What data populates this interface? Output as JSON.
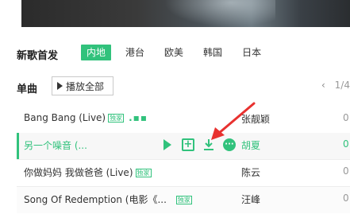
{
  "section": {
    "title": "新歌首发"
  },
  "tabs": [
    {
      "label": "内地",
      "active": true
    },
    {
      "label": "港台",
      "active": false
    },
    {
      "label": "欧美",
      "active": false
    },
    {
      "label": "韩国",
      "active": false
    },
    {
      "label": "日本",
      "active": false
    }
  ],
  "singles": {
    "title": "单曲",
    "play_all_label": "播放全部",
    "pager_text": "1/4"
  },
  "songs": [
    {
      "name": "Bang Bang (Live)",
      "tag": "独家",
      "singer": "张靓颖",
      "duration": "0"
    },
    {
      "name": "另一个噪音 (...",
      "singer": "胡夏",
      "duration": "0"
    },
    {
      "name": "你做妈妈 我做爸爸 (Live)",
      "tag": "独家",
      "singer": "陈云",
      "duration": "0"
    },
    {
      "name": "Song Of Redemption (电影《...",
      "tag": "独家",
      "singer": "汪峰",
      "duration": "0"
    }
  ],
  "colors": {
    "accent": "#31c27c",
    "annotation_arrow": "#e8312f"
  },
  "icons": [
    "play-icon",
    "add-icon",
    "download-icon",
    "more-icon",
    "playing-indicator-icon"
  ]
}
